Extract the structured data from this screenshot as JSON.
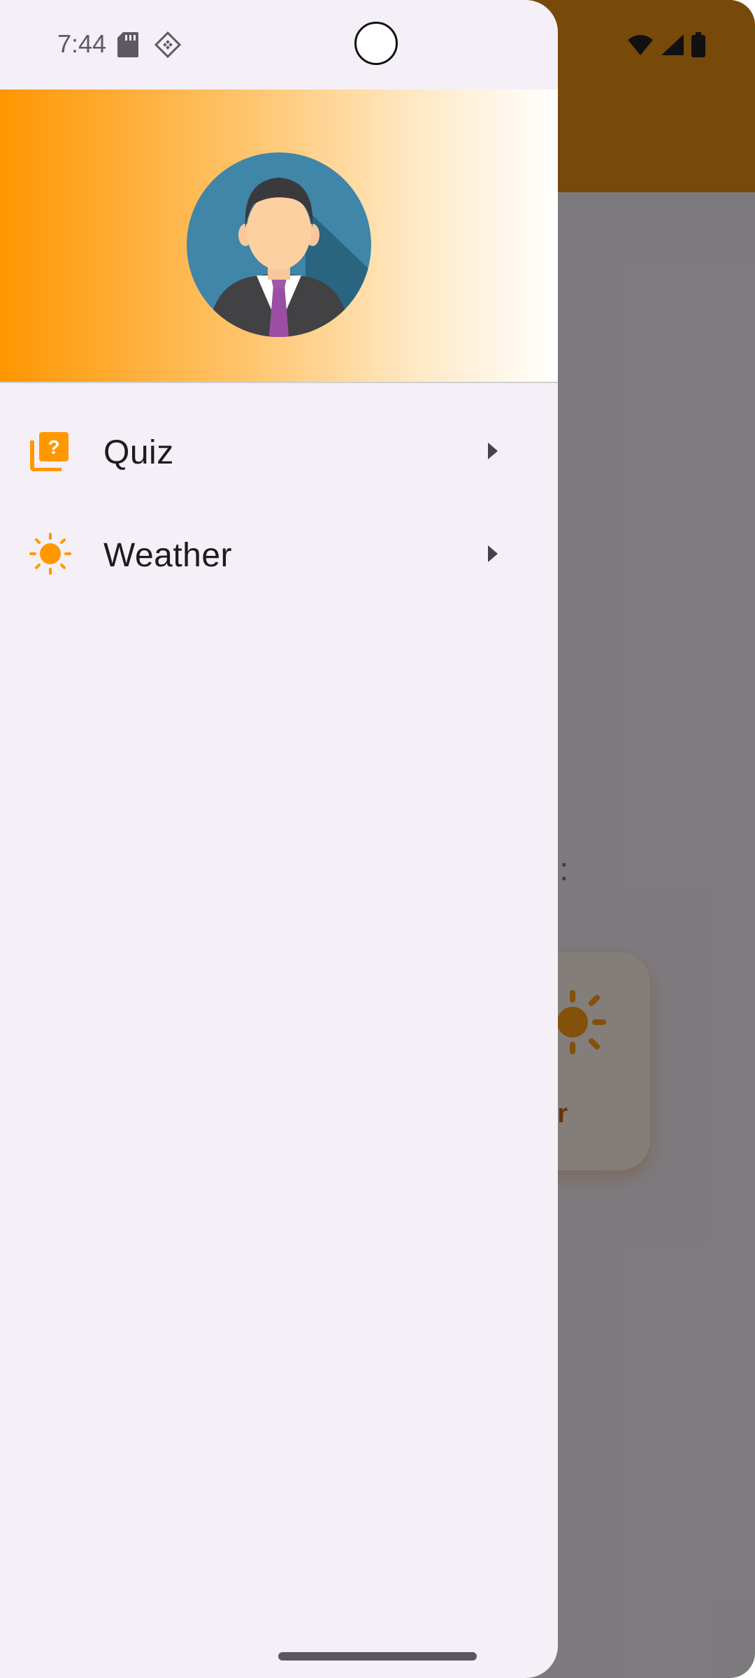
{
  "status_bar": {
    "time": "7:44",
    "icons": [
      "sd-card-icon",
      "developer-mode-icon",
      "wifi-icon",
      "cellular-signal-icon",
      "battery-icon"
    ]
  },
  "background_screen": {
    "prompt_text_partial": "n :",
    "card_label_partial": "her",
    "accent_color": "#e58a00"
  },
  "drawer": {
    "header": {
      "gradient_colors": [
        "#ff9600",
        "#ffffff"
      ],
      "avatar": "user-avatar"
    },
    "items": [
      {
        "label": "Quiz",
        "icon": "quiz-icon"
      },
      {
        "label": "Weather",
        "icon": "sun-icon"
      }
    ],
    "icon_color": "#ff9800"
  }
}
